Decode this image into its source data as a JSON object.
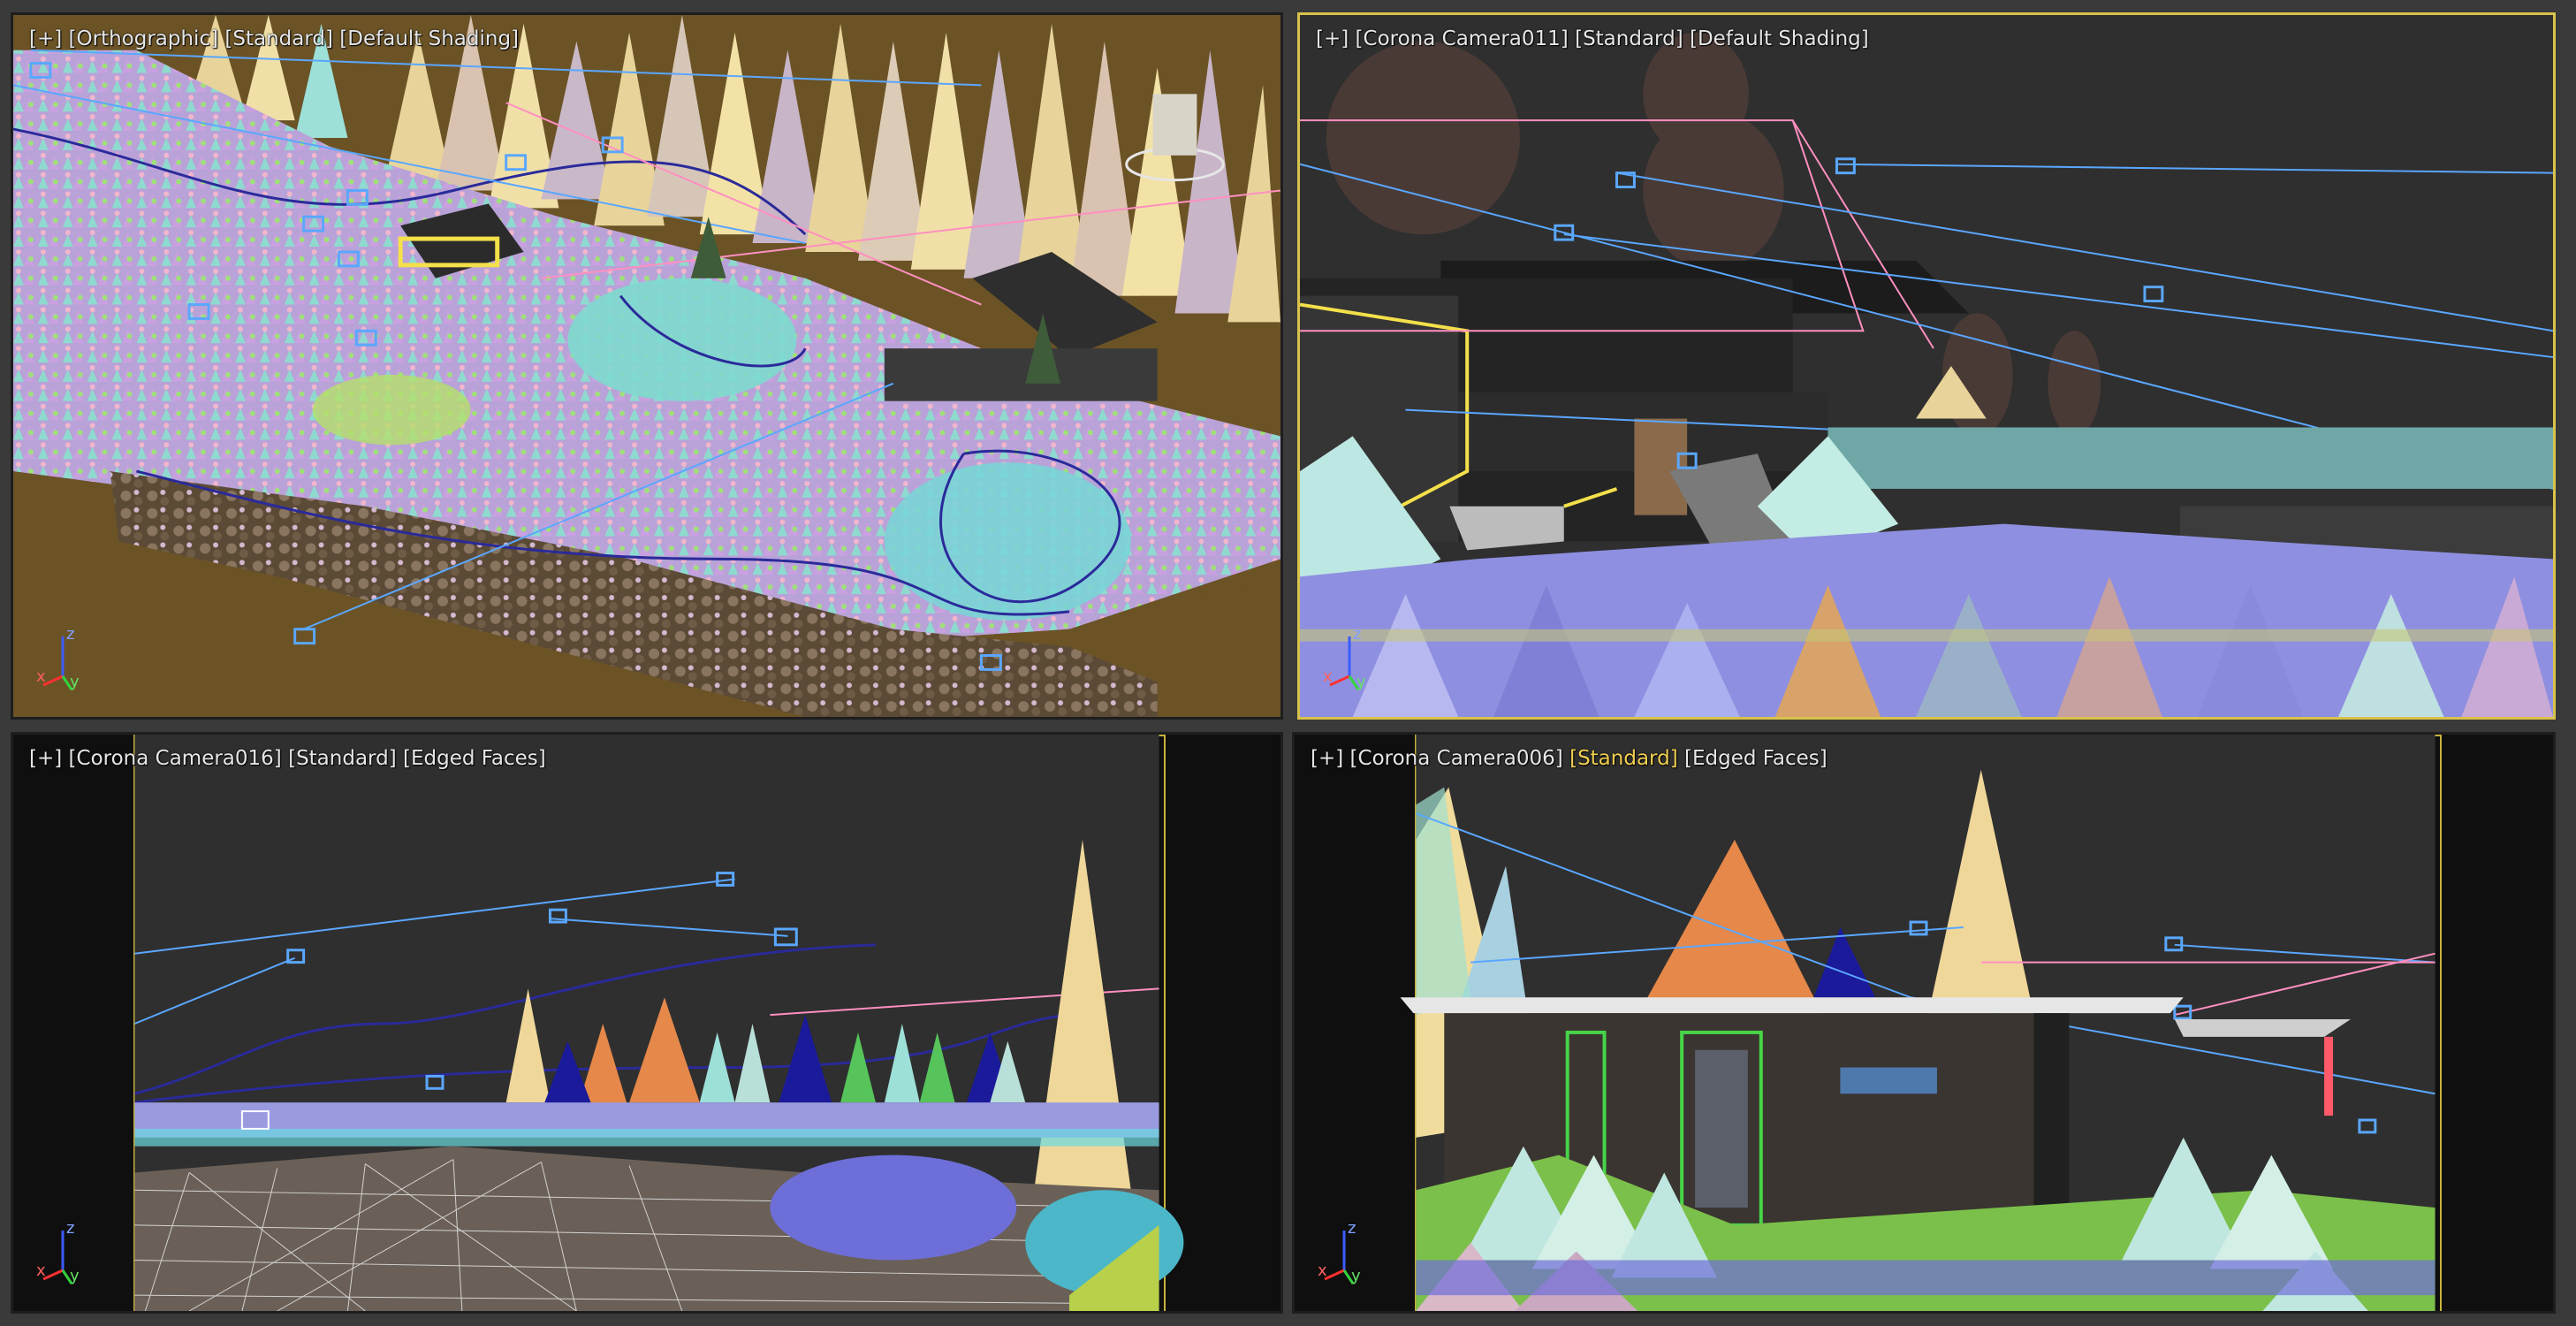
{
  "viewports": [
    {
      "id": "top-left",
      "label": {
        "plus": "[+]",
        "view": "[Orthographic]",
        "mode": "[Standard]",
        "shading": "[Default Shading]"
      }
    },
    {
      "id": "top-right",
      "label": {
        "plus": "[+]",
        "view": "[Corona Camera011]",
        "mode": "[Standard]",
        "shading": "[Default Shading]"
      }
    },
    {
      "id": "bottom-left",
      "label": {
        "plus": "[+]",
        "view": "[Corona Camera016]",
        "mode": "[Standard]",
        "shading": "[Edged Faces]"
      }
    },
    {
      "id": "bottom-right",
      "label": {
        "plus": "[+]",
        "view": "[Corona Camera006]",
        "mode": "[Standard]",
        "shading": "[Edged Faces]"
      }
    }
  ],
  "axes": {
    "x": "x",
    "y": "y",
    "z": "z"
  },
  "colors": {
    "active_border": "#d8c24a",
    "inactive_border": "#1e1e1e",
    "viewport_bg_dark": "#2e2e2e",
    "ground_brown": "#6b5326",
    "camera_blue": "#5aa7ff",
    "spline_pink": "#ff8fc0"
  }
}
